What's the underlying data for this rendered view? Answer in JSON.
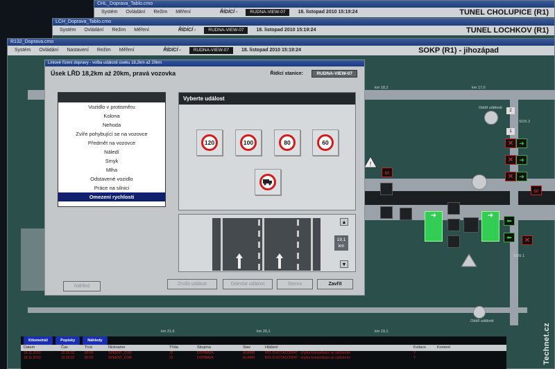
{
  "back_window_1": {
    "title": "CHL_Doprava_Tablo.cmo",
    "menu": [
      "Systém",
      "Ovládání",
      "Režim",
      "Měření"
    ],
    "ridici": "ŘÍDÍCÍ -",
    "station": "RUDNA-VIEW-07",
    "datetime": "18. listopad 2010 15:19:24",
    "window_title": "TUNEL CHOLUPICE (R1)"
  },
  "back_window_2": {
    "title": "LCH_Doprava_Tablo.cmo",
    "menu": [
      "Systém",
      "Ovládání",
      "Režim",
      "Měření"
    ],
    "ridici": "ŘÍDÍCÍ -",
    "station": "RUDNA-VIEW-07",
    "datetime": "18. listopad 2010 15:19:24",
    "window_title": "TUNEL LOCHKOV (R1)"
  },
  "main_window": {
    "title": "R132_Doprava.cmo",
    "menu": [
      "Systém",
      "Ovládání",
      "Nastavení",
      "Režim",
      "Měření"
    ],
    "ridici": "ŘÍDÍCÍ -",
    "station": "RUDNA-VIEW-07",
    "datetime": "18. listopad 2010 15:19:24",
    "window_title": "SOKP (R1) - jihozápad",
    "km_labels": [
      "km 18,2",
      "km 17,0",
      "km 21,6",
      "km 20,1",
      "km 19,1"
    ],
    "labels": {
      "odd1": "Oddíl události",
      "odd2": "Oddíl události",
      "sos2": "SOS 2",
      "sos1": "SOS 1"
    },
    "counters": {
      "c1": "2",
      "c2": "1",
      "red_values": [
        "80",
        "80"
      ]
    }
  },
  "dialog": {
    "title": "Liniové řízení dopravy - volba události úseku 18,2km až 20km",
    "heading": "Úsek LŘD 18,2km až 20km, pravá vozovka",
    "station_label": "Řídící stanice:",
    "station_value": "RUDNA-VIEW-07",
    "events": [
      "Vozidlo v protisměru",
      "Kolona",
      "Nehoda",
      "Zvíře pohybující se na vozovce",
      "Předmět na vozovce",
      "Náledí",
      "Smyk",
      "Mlha",
      "Odstavené vozidlo",
      "Práce na silnici",
      "Omezení rychlosti"
    ],
    "selected_index": 10,
    "event_panel_title": "Vyberte událost",
    "speed_signs": [
      "120",
      "100",
      "80",
      "60"
    ],
    "truck_sign": "truck-no-overtaking-icon",
    "km_value": "19,1",
    "km_unit": "km",
    "buttons": {
      "nahled": "Náhled",
      "zrusit": "Zrušit událost",
      "odeslat": "Odeslat událost",
      "storno": "Storno",
      "zavrit": "Zavřít"
    }
  },
  "bottom": {
    "tabs": [
      "Kilometráž",
      "Popisky",
      "Náhledy"
    ],
    "columns": [
      "Datum",
      "Čas",
      "Trvá",
      "Nickname",
      "Třída",
      "Skupina",
      "Stav",
      "Hlášení",
      "Kvitace",
      "Koment"
    ],
    "rows": [
      [
        "18.11.2010",
        "15:10:32",
        "00:09",
        "SPEENT_COR",
        "22",
        "DOPRAVA",
        "ALARM",
        "R01-D-R1TACO0047 - chyba komunikace se zařízením",
        "Y",
        ""
      ],
      [
        "18.11.2010",
        "15:10:32",
        "00:09",
        "SPEENT_COR",
        "22",
        "DOPRAVA",
        "ALARM",
        "R01-D-R1TACO0047 - chyba komunikace se zařízením",
        "Y",
        ""
      ]
    ]
  },
  "watermark": "Technet.cz",
  "colors": {
    "screen_bg": "#2b4f4a",
    "selected": "#11206e",
    "sign_ring": "#d21c1c",
    "green_signal": "#33cc55"
  }
}
